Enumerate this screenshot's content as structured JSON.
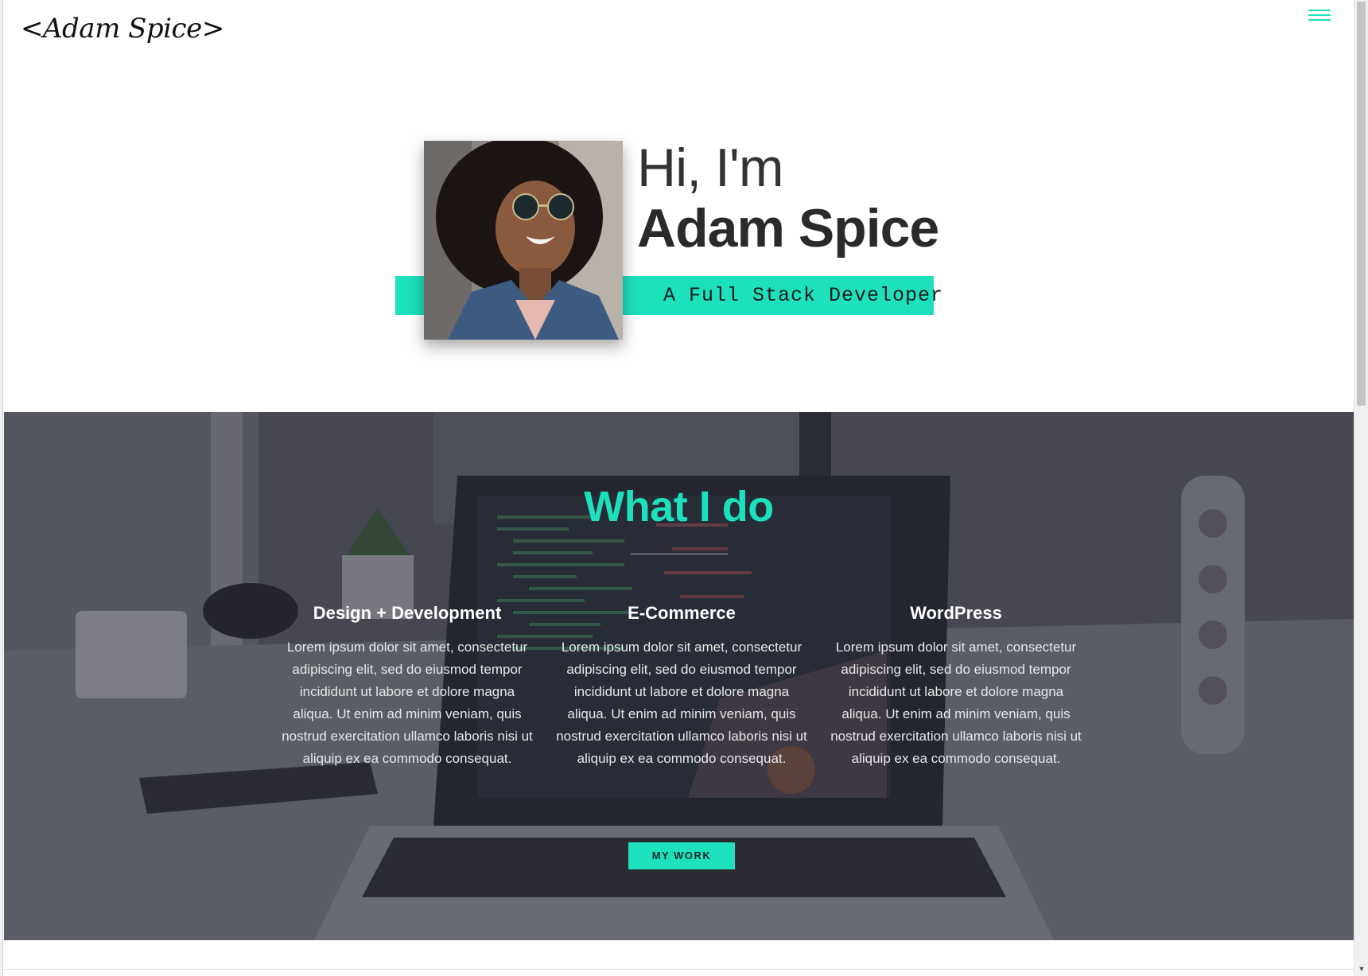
{
  "header": {
    "logo": "<Adam Spice>",
    "menu_icon": "hamburger-icon"
  },
  "hero": {
    "greeting": "Hi, I'm",
    "name": "Adam Spice",
    "tagline": "A Full Stack Developer",
    "portrait_alt": "portrait photo"
  },
  "services": {
    "title": "What I do",
    "items": [
      {
        "title": "Design + Development",
        "text": "Lorem ipsum dolor sit amet, consectetur adipiscing elit, sed do eiusmod tempor incididunt ut labore et dolore magna aliqua. Ut enim ad minim veniam, quis nostrud exercitation ullamco laboris nisi ut aliquip ex ea commodo consequat."
      },
      {
        "title": "E-Commerce",
        "text": "Lorem ipsum dolor sit amet, consectetur adipiscing elit, sed do eiusmod tempor incididunt ut labore et dolore magna aliqua. Ut enim ad minim veniam, quis nostrud exercitation ullamco laboris nisi ut aliquip ex ea commodo consequat."
      },
      {
        "title": "WordPress",
        "text": "Lorem ipsum dolor sit amet, consectetur adipiscing elit, sed do eiusmod tempor incididunt ut labore et dolore magna aliqua. Ut enim ad minim veniam, quis nostrud exercitation ullamco laboris nisi ut aliquip ex ea commodo consequat."
      }
    ],
    "button_label": "MY WORK"
  },
  "colors": {
    "accent": "#1de0bd",
    "text_dark": "#2a2a2a"
  }
}
